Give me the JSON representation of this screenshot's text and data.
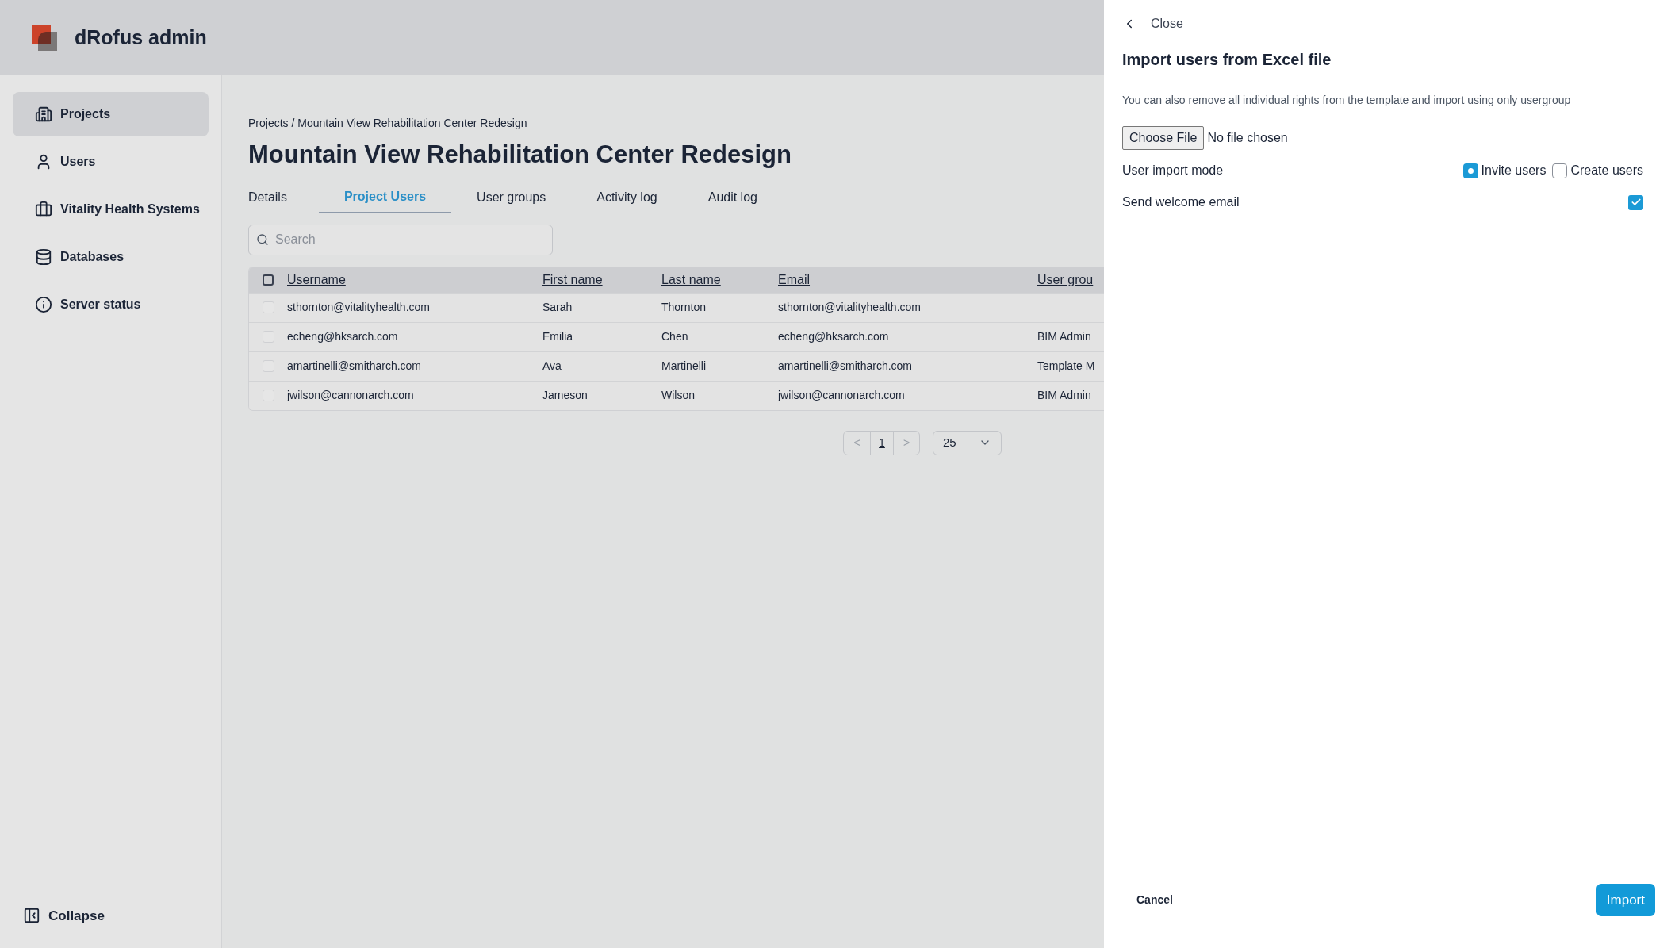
{
  "app": {
    "title": "dRofus admin"
  },
  "sidebar": {
    "items": [
      {
        "label": "Projects",
        "selected": true
      },
      {
        "label": "Users",
        "selected": false
      },
      {
        "label": "Vitality Health Systems",
        "selected": false
      },
      {
        "label": "Databases",
        "selected": false
      },
      {
        "label": "Server status",
        "selected": false
      }
    ],
    "collapse": "Collapse"
  },
  "breadcrumb": "Projects / Mountain View Rehabilitation Center Redesign",
  "page_title": "Mountain View Rehabilitation Center Redesign",
  "tabs": [
    {
      "label": "Details",
      "selected": false
    },
    {
      "label": "Project Users",
      "selected": true
    },
    {
      "label": "User groups",
      "selected": false
    },
    {
      "label": "Activity log",
      "selected": false
    },
    {
      "label": "Audit log",
      "selected": false
    }
  ],
  "search": {
    "placeholder": "Search"
  },
  "table": {
    "columns": [
      "Username",
      "First name",
      "Last name",
      "Email",
      "User grou"
    ],
    "header_checked": false,
    "rows": [
      {
        "checked": false,
        "cells": [
          "sthornton@vitalityhealth.com",
          "Sarah",
          "Thornton",
          "sthornton@vitalityhealth.com",
          ""
        ]
      },
      {
        "checked": false,
        "cells": [
          "echeng@hksarch.com",
          "Emilia",
          "Chen",
          "echeng@hksarch.com",
          "BIM Admin"
        ]
      },
      {
        "checked": false,
        "cells": [
          "amartinelli@smitharch.com",
          "Ava",
          "Martinelli",
          "amartinelli@smitharch.com",
          "Template M"
        ]
      },
      {
        "checked": false,
        "cells": [
          "jwilson@cannonarch.com",
          "Jameson",
          "Wilson",
          "jwilson@cannonarch.com",
          "BIM Admin"
        ]
      }
    ]
  },
  "pagination": {
    "prev": "<",
    "page": "1",
    "next": ">",
    "page_size": "25"
  },
  "panel": {
    "close": "Close",
    "title": "Import users from Excel file",
    "description": "You can also remove all individual rights from the template and import using only usergroup",
    "file_button": "Choose File",
    "file_status": "No file chosen",
    "mode_label": "User import mode",
    "modes": [
      {
        "label": "Invite users",
        "selected": true
      },
      {
        "label": "Create users",
        "selected": false
      }
    ],
    "welcome_label": "Send welcome email",
    "welcome_checked": true,
    "cancel": "Cancel",
    "import": "Import"
  }
}
